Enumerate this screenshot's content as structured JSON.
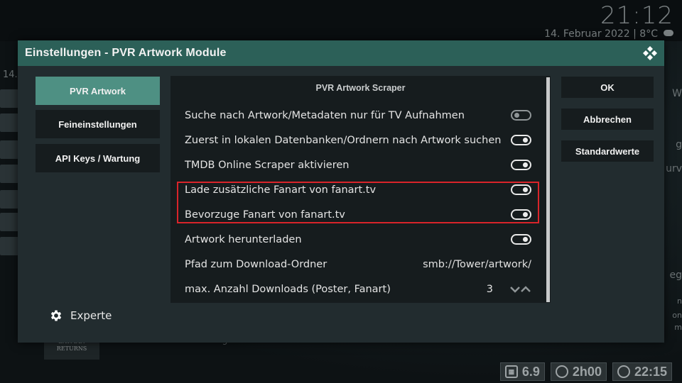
{
  "background": {
    "clock": "21:12",
    "date": "14. Februar 2022 | 8°C",
    "left_number": "14.",
    "movie_thumb_text": "BATMAN RETURNS",
    "right_glyphs": [
      "W",
      "g",
      "urv",
      "eg",
      "n",
      "on",
      "m"
    ],
    "bottom_text": "...ge"
  },
  "statusbar": {
    "rating": "6.9",
    "duration": "2h00",
    "end_time": "22:15"
  },
  "dialog": {
    "title": "Einstellungen - PVR Artwork Module",
    "nav": [
      {
        "label": "PVR Artwork",
        "active": true
      },
      {
        "label": "Feineinstellungen",
        "active": false
      },
      {
        "label": "API Keys / Wartung",
        "active": false
      }
    ],
    "experte_label": "Experte",
    "panel_heading": "PVR Artwork Scraper",
    "settings": [
      {
        "label": "Suche nach Artwork/Metadaten nur für TV Aufnahmen",
        "type": "toggle",
        "on": false
      },
      {
        "label": "Zuerst in lokalen Datenbanken/Ordnern nach Artwork suchen",
        "type": "toggle",
        "on": true
      },
      {
        "label": "TMDB Online Scraper aktivieren",
        "type": "toggle",
        "on": true
      },
      {
        "label": "Lade zusätzliche Fanart von fanart.tv",
        "type": "toggle",
        "on": true
      },
      {
        "label": "Bevorzuge Fanart von fanart.tv",
        "type": "toggle",
        "on": true
      },
      {
        "label": "Artwork herunterladen",
        "type": "toggle",
        "on": true
      },
      {
        "label": "Pfad zum Download-Ordner",
        "type": "value",
        "value": "smb://Tower/artwork/"
      },
      {
        "label": "max. Anzahl Downloads (Poster, Fanart)",
        "type": "spinner",
        "value": "3"
      }
    ],
    "buttons": {
      "ok": "OK",
      "cancel": "Abbrechen",
      "defaults": "Standardwerte"
    }
  }
}
